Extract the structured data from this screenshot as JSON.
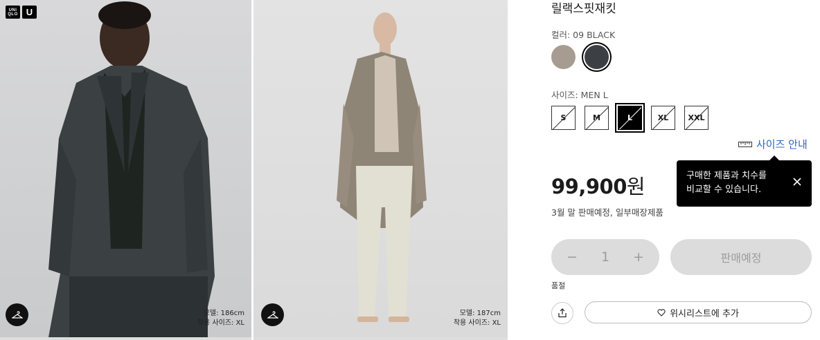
{
  "brand": {
    "logo_text": "UNI QLO",
    "logo_u": "U"
  },
  "gallery": [
    {
      "model_height": "모델: 186cm",
      "model_size": "착용 사이즈: XL"
    },
    {
      "model_height": "모델: 187cm",
      "model_size": "착용 사이즈: XL"
    }
  ],
  "product": {
    "title": "릴랙스핏재킷",
    "color_label": "컬러: 09 BLACK",
    "colors": [
      {
        "name": "beige",
        "hex": "#a79c92"
      },
      {
        "name": "black",
        "hex": "#3c3f43"
      }
    ],
    "size_label": "사이즈: MEN L",
    "sizes": [
      "S",
      "M",
      "L",
      "XL",
      "XXL"
    ],
    "selected_size": "L",
    "size_guide": "사이즈 안내",
    "tooltip": {
      "line1": "구매한 제품과 치수를",
      "line2": "비교할 수 있습니다."
    },
    "price_number": "99,900",
    "price_unit": "원",
    "note": "3월 말 판매예정, 일부매장제품",
    "quantity": "1",
    "qty_minus": "−",
    "qty_plus": "+",
    "cta": "판매예정",
    "stock_status": "품절",
    "wishlist": "위시리스트에 추가"
  },
  "colors": {
    "link": "#2b63c8",
    "disabled_bg": "#dcdcdc",
    "disabled_text": "#9c9c9c"
  }
}
